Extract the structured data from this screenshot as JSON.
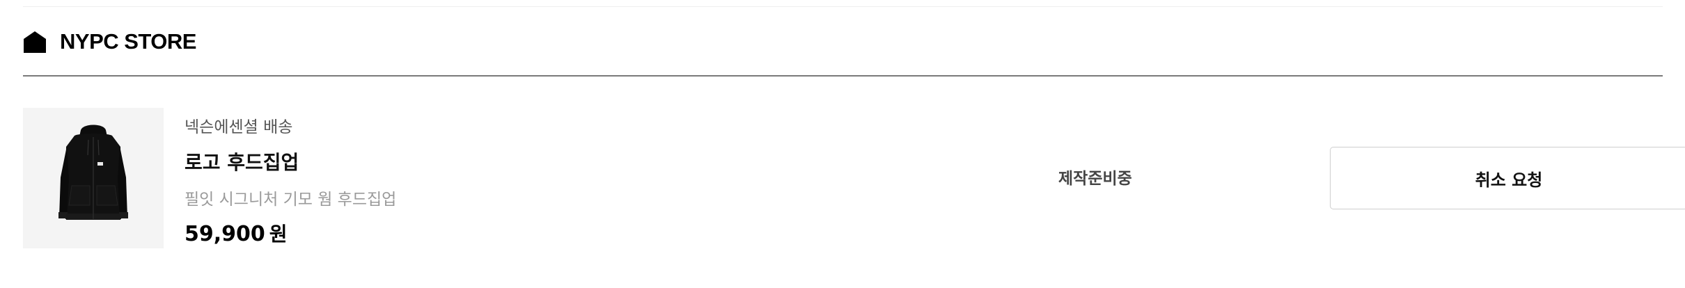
{
  "store": {
    "name": "NYPC STORE",
    "icon": "house-icon"
  },
  "order_item": {
    "shipping_method": "넥슨에센셜 배송",
    "product_name": "로고 후드집업",
    "option": "필잇 시그니처 기모 웜 후드집업",
    "price": "59,900",
    "price_unit": "원",
    "thumbnail_icon": "black-hoodie-image",
    "status": "제작준비중",
    "cancel_label": "취소 요청"
  },
  "colors": {
    "text": "#111111",
    "muted": "#9a9a9a",
    "thumb_bg": "#f4f4f4",
    "rule": "#7a7a7a",
    "button_border": "#cfcfcf"
  }
}
